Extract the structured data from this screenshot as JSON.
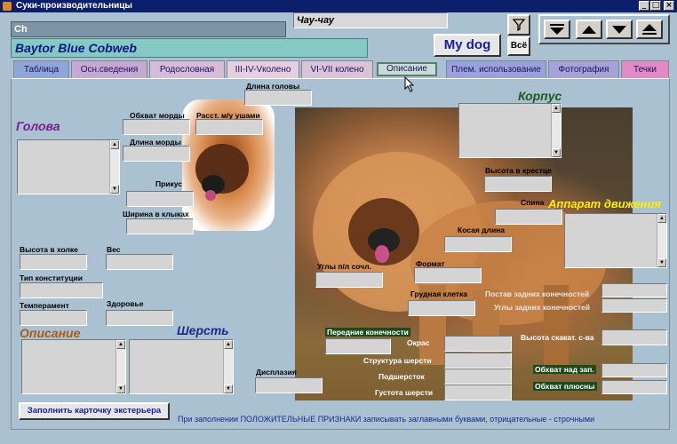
{
  "window": {
    "title": "Суки-производительницы"
  },
  "header": {
    "search_value": "Ch",
    "breed": "Чау-чау",
    "dog_name": "Baytor Blue Cobweb",
    "my_dog_button": "My dog",
    "all_button": "Всё",
    "filter_icon": "filter-icon"
  },
  "tabs": [
    {
      "label": "Таблица",
      "color": "#8fa6d8"
    },
    {
      "label": "Осн.сведения",
      "color": "#c6a9d2"
    },
    {
      "label": "Родословная",
      "color": "#d5bdd9"
    },
    {
      "label": "III-IV-Vколено",
      "color": "#e4cfe0"
    },
    {
      "label": "VI-VII колено",
      "color": "#d9c3d6"
    },
    {
      "label": "Описание",
      "color": "#c8dcd6"
    },
    {
      "label": "Плем. использование",
      "color": "#9aa2dc"
    },
    {
      "label": "Фотография",
      "color": "#a6a2d8"
    },
    {
      "label": "Течки",
      "color": "#e28ac6"
    }
  ],
  "sections": {
    "head": "Голова",
    "body": "Корпус",
    "movement": "Аппарат движения",
    "description": "Описание",
    "coat": "Шерсть"
  },
  "labels": {
    "head_length": "Длина головы",
    "muzzle_girth": "Обхват морды",
    "ear_distance": "Расст. м/у ушами",
    "muzzle_length": "Длина морды",
    "bite": "Прикус",
    "fang_width": "Ширина в клыках",
    "withers_height": "Высота в холке",
    "weight": "Вес",
    "constitution": "Тип конституции",
    "temperament": "Темперамент",
    "health": "Здоровье",
    "croup_height": "Высота в крестце",
    "back": "Спина",
    "oblique_length": "Косая длина",
    "shoulder_angles": "Углы п/л сочл.",
    "format": "Формат",
    "chest": "Грудная клетка",
    "front_legs": "Передние конечности",
    "rear_stance": "Постав задних конечностей",
    "rear_angles": "Углы задних конечностей",
    "hock_height": "Высота скакат. с-ва",
    "pastern_girth": "Обхват над зап.",
    "metacarpus_girth": "Обхват плюсны",
    "dysplasia": "Дисплазия",
    "color": "Окрас",
    "coat_structure": "Структура шерсти",
    "undercoat": "Подшерсток",
    "coat_density": "Густота шерсти"
  },
  "fill_button": "Заполнить карточку экстерьера",
  "footer_note": "При заполнении ПОЛОЖИТЕЛЬНЫЕ ПРИЗНАКИ записывать заглавными буквами, отрицательные - строчными"
}
